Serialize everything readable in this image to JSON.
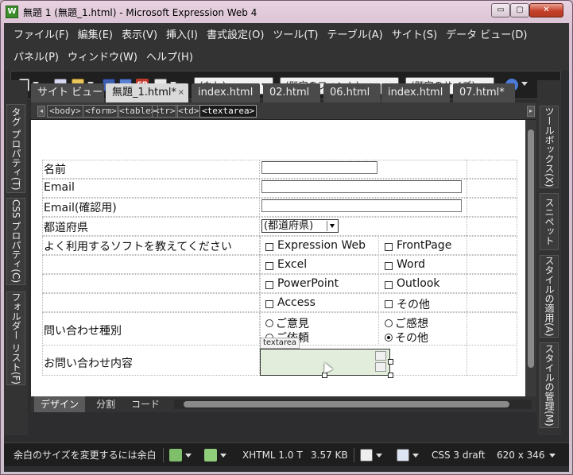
{
  "window": {
    "title": "無題 1 (無題_1.html) - Microsoft Expression Web 4",
    "app_icon_glyph": "W",
    "minimize_glyph": "▭",
    "maximize_glyph": "▢",
    "close_glyph": "✕"
  },
  "menu": {
    "row1": [
      "ファイル(F)",
      "編集(E)",
      "表示(V)",
      "挿入(I)",
      "書式設定(O)",
      "ツール(T)",
      "テーブル(A)",
      "サイト(S)",
      "データ ビュー(D)"
    ],
    "row2": [
      "パネル(P)",
      "ウィンドウ(W)",
      "ヘルプ(H)"
    ]
  },
  "toolbar": {
    "style_combo": "(なし)",
    "font_combo": "(既定のフォント)",
    "size_combo": "(既定のサイズ)",
    "icons": [
      "new-page-icon",
      "open-icon",
      "folder-icon",
      "save-icon",
      "save-all-icon",
      "sharepoint-icon",
      "preview-icon",
      "undo-icon"
    ],
    "sharepoint_label": "SP"
  },
  "left_panel": {
    "tabs": [
      "タグ プロパティ(T)",
      "CSS プロパティ(C)",
      "フォルダー リスト(F)"
    ]
  },
  "right_panel": {
    "tabs": [
      "ツールボックス(X)",
      "スニペット",
      "スタイルの適用(A)",
      "スタイルの管理(M)"
    ]
  },
  "doc_tabs": [
    "サイト ビュー",
    "無題_1.html*",
    "index.html",
    "02.html",
    "06.html",
    "index.html",
    "07.html*"
  ],
  "doc_tab_close": "×",
  "tag_bar": {
    "tags": [
      "<body>",
      "<form>",
      "<table>",
      "<tr>",
      "<td>",
      "<textarea>"
    ],
    "scroll_left": "◂",
    "scroll_right": "▸"
  },
  "form": {
    "name_label": "名前",
    "email_label": "Email",
    "email_confirm_label": "Email(確認用)",
    "prefecture_label": "都道府県",
    "prefecture_value": "(都道府県)",
    "software_label": "よく利用するソフトを教えてください",
    "software_options": [
      "Expression Web",
      "FrontPage",
      "Excel",
      "Word",
      "PowerPoint",
      "Outlook",
      "Access",
      "その他"
    ],
    "inquiry_type_label": "問い合わせ種別",
    "inquiry_types": [
      "ご意見",
      "ご感想",
      "ご依頼",
      "その他"
    ],
    "inquiry_selected_index": 3,
    "content_label": "お問い合わせ内容",
    "textarea_badge": "textarea"
  },
  "view_tabs": [
    "デザイン",
    "分割",
    "コード"
  ],
  "status": {
    "message": "余白のサイズを変更するには余白",
    "doctype": "XHTML 1.0 T",
    "filesize": "3.57 KB",
    "css_mode": "CSS 3 draft",
    "dimensions": "620 x 346"
  }
}
